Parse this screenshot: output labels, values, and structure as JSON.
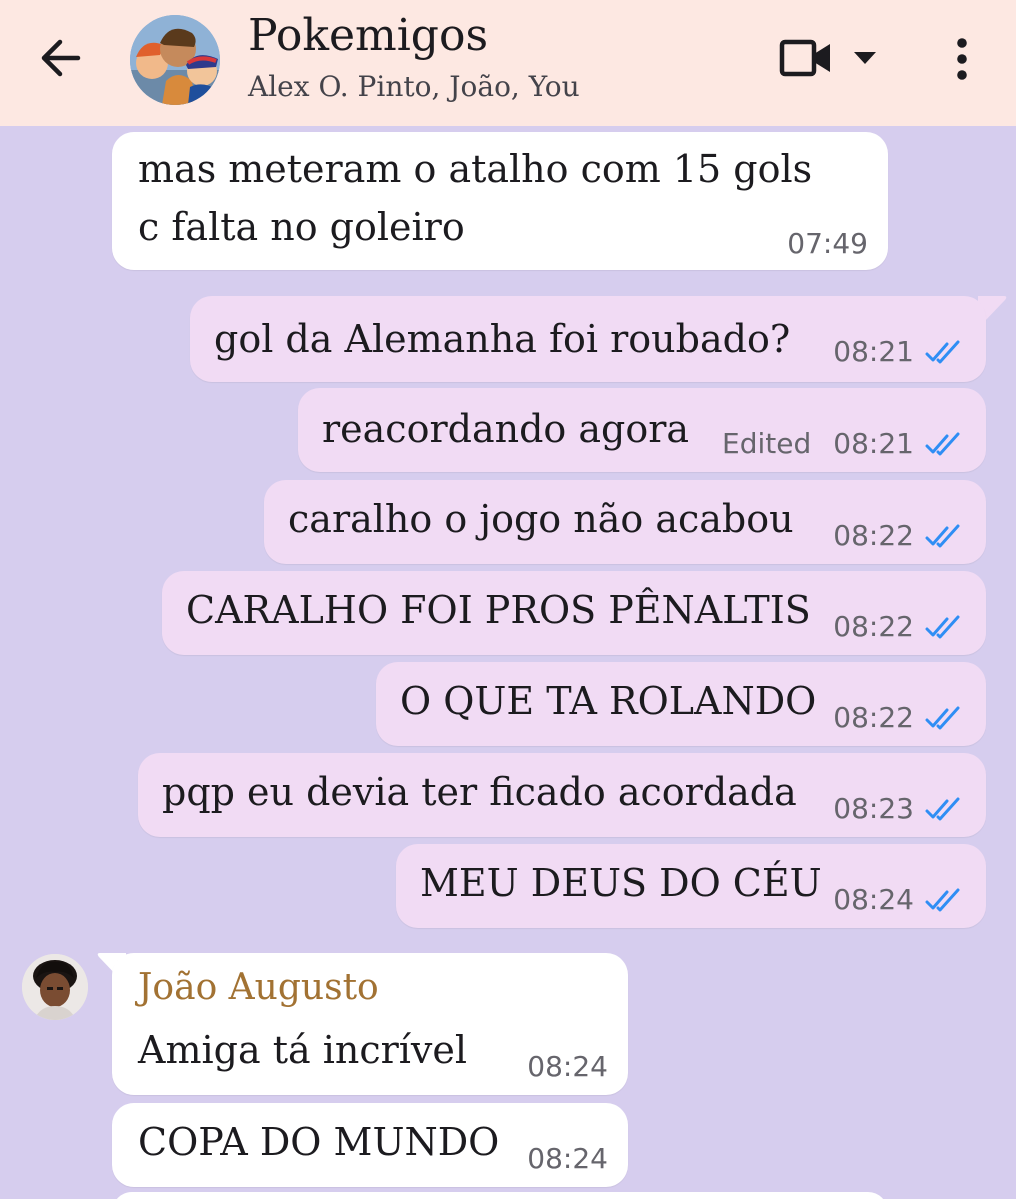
{
  "header": {
    "title": "Pokemigos",
    "members": "Alex O. Pinto, João, You"
  },
  "messages": [
    {
      "direction": "in",
      "lines": [
        "mas meteram o atalho com 15 gols",
        "c falta no goleiro"
      ],
      "time": "07:49"
    },
    {
      "direction": "out",
      "text": "gol da Alemanha foi roubado?",
      "time": "08:21",
      "status": "read"
    },
    {
      "direction": "out",
      "text": "reacordando agora",
      "edited": "Edited",
      "time": "08:21",
      "status": "read"
    },
    {
      "direction": "out",
      "text": "caralho o jogo não acabou",
      "time": "08:22",
      "status": "read"
    },
    {
      "direction": "out",
      "text": "CARALHO FOI PROS PÊNALTIS",
      "time": "08:22",
      "status": "read"
    },
    {
      "direction": "out",
      "text": "O QUE TA ROLANDO",
      "time": "08:22",
      "status": "read"
    },
    {
      "direction": "out",
      "text": "pqp eu devia ter ficado acordada",
      "time": "08:23",
      "status": "read"
    },
    {
      "direction": "out",
      "text": "MEU DEUS DO CÉU",
      "time": "08:24",
      "status": "read"
    },
    {
      "direction": "in",
      "sender": "João Augusto",
      "text": "Amiga tá incrível",
      "time": "08:24"
    },
    {
      "direction": "in",
      "text": "COPA DO MUNDO",
      "time": "08:24"
    }
  ],
  "icons": {
    "back": "arrow-back-icon",
    "video": "video-call-icon",
    "dropdown": "caret-down-icon",
    "menu": "more-vert-icon",
    "read": "double-check-icon"
  },
  "colors": {
    "chat_background": "#d6cdee",
    "header_background": "#fde8e2",
    "incoming_bubble": "#ffffff",
    "outgoing_bubble": "#f1dbf4",
    "read_check": "#2f8ef4",
    "sender_name": "#a27233"
  }
}
